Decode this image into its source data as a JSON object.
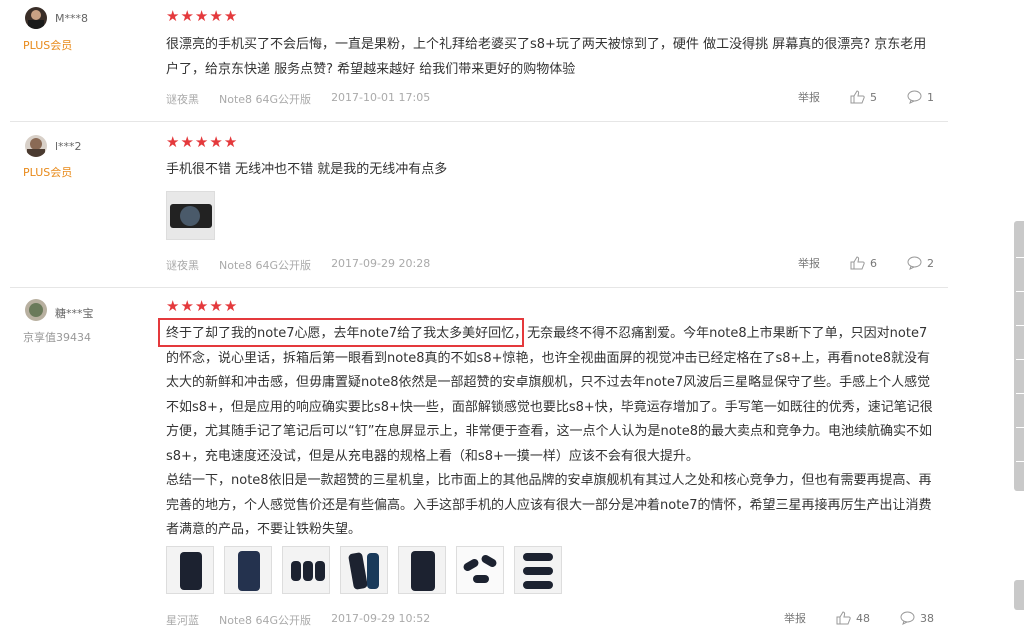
{
  "reviews": [
    {
      "username": "M***8",
      "badge": "PLUS会员",
      "text": "很漂亮的手机买了不会后悔，一直是果粉，上个礼拜给老婆买了s8+玩了两天被惊到了，硬件 做工没得挑 屏幕真的很漂亮? 京东老用户了，给京东快递 服务点赞? 希望越来越好 给我们带来更好的购物体验",
      "color": "谜夜黑",
      "spec": "Note8 64G公开版",
      "date": "2017-10-01 17:05",
      "report": "举报",
      "likes": "5",
      "comments": "1"
    },
    {
      "username": "l***2",
      "badge": "PLUS会员",
      "text": "手机很不错 无线冲也不错 就是我的无线冲有点多",
      "color": "谜夜黑",
      "spec": "Note8 64G公开版",
      "date": "2017-09-29 20:28",
      "report": "举报",
      "likes": "6",
      "comments": "2"
    },
    {
      "username": "糖***宝",
      "badge": "京享值39434",
      "text_p1": "终于了却了我的note7心愿，去年note7给了我太多美好回忆，无奈最终不得不忍痛割爱。今年note8上市果断下了单，只因对note7的怀念，说心里话，拆箱后第一眼看到note8真的不如s8+惊艳，也许全视曲面屏的视觉冲击已经定格在了s8+上，再看note8就没有太大的新鲜和冲击感，但毋庸置疑note8依然是一部超赞的安卓旗舰机，只不过去年note7风波后三星略显保守了些。手感上个人感觉不如s8+，但是应用的响应确实要比s8+快一些，面部解锁感觉也要比s8+快，毕竟运存增加了。手写笔一如既往的优秀，速记笔记很方便，尤其随手记了笔记后可以“钉”在息屏显示上，非常便于查看，这一点个人认为是note8的最大卖点和竞争力。电池续航确实不如s8+，充电速度还没试，但是从充电器的规格上看（和s8+一摸一样）应该不会有很大提升。",
      "text_p2": "总结一下，note8依旧是一款超赞的三星机皇，比市面上的其他品牌的安卓旗舰机有其过人之处和核心竞争力，但也有需要再提高、再完善的地方，个人感觉售价还是有些偏高。入手这部手机的人应该有很大一部分是冲着note7的情怀，希望三星再接再厉生产出让消费者满意的产品，不要让铁粉失望。",
      "color": "星河蓝",
      "spec": "Note8 64G公开版",
      "date": "2017-09-29 10:52",
      "report": "举报",
      "likes": "48",
      "comments": "38"
    }
  ],
  "icons": {
    "star": "★",
    "like": "thumbs-up-icon",
    "comment": "comment-icon"
  },
  "colors": {
    "star": "#e4393c",
    "plus_badge": "#e88a1a",
    "highlight_box": "#e4393c"
  }
}
